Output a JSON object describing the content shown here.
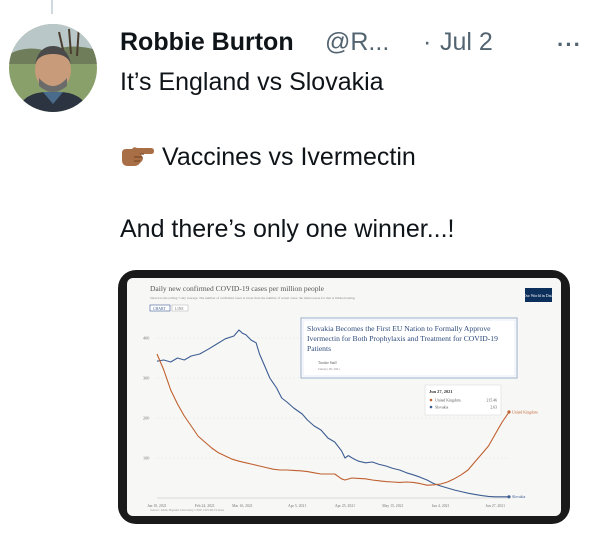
{
  "tweet": {
    "author_name": "Robbie Burton",
    "handle": "@R...",
    "separator": "·",
    "date": "Jul 2",
    "more_label": "···",
    "lines": [
      "It’s England vs Slovakia",
      "Vaccines vs Ivermectin",
      "And there’s only one winner...!"
    ]
  },
  "chart_image": {
    "title": "Daily new confirmed COVID-19 cases per million people",
    "subtitle": "Shown is the rolling 7-day average. The number of confirmed cases is lower than the number of actual cases; the main reason for that is limited testing.",
    "buttons": [
      "CHART",
      "LINE"
    ],
    "badge": "Our World in Data",
    "callout_text": [
      "Slovakia Becomes the First EU Nation to Formally Approve",
      "Ivermectin for Both Prophylaxis and Treatment for COVID-19",
      "Patients"
    ],
    "callout_source": "Trackie Staff",
    "callout_date": "January 28, 2021",
    "tooltip": {
      "date": "Jun 27, 2021",
      "rows": [
        {
          "name": "United Kingdom",
          "value": "215.46",
          "color": "#c0602f"
        },
        {
          "name": "Slovakia",
          "value": "2.63",
          "color": "#3d5d93"
        }
      ]
    },
    "footer": "Source: Johns Hopkins University CSSE COVID-19 Data"
  },
  "chart_data": {
    "type": "line",
    "title": "Daily new confirmed COVID-19 cases per million people",
    "y_ticks": [
      "400",
      "300",
      "200",
      "100"
    ],
    "x_ticks": [
      "Jan 10, 2021",
      "Feb 24, 2021",
      "Mar 16, 2021",
      "Apr 5, 2021",
      "Apr 25, 2021",
      "May 15, 2021",
      "Jun 4, 2021",
      "Jun 27, 2021"
    ],
    "ylim": [
      0,
      450
    ],
    "series": [
      {
        "name": "Slovakia",
        "color": "#3d5d93",
        "end_label": "Slovakia",
        "values": [
          [
            0,
            342
          ],
          [
            4,
            345
          ],
          [
            8,
            340
          ],
          [
            12,
            350
          ],
          [
            16,
            345
          ],
          [
            20,
            355
          ],
          [
            25,
            360
          ],
          [
            30,
            372
          ],
          [
            35,
            385
          ],
          [
            40,
            398
          ],
          [
            45,
            405
          ],
          [
            48,
            420
          ],
          [
            50,
            412
          ],
          [
            52,
            408
          ],
          [
            55,
            395
          ],
          [
            58,
            388
          ],
          [
            60,
            360
          ],
          [
            63,
            330
          ],
          [
            66,
            300
          ],
          [
            70,
            275
          ],
          [
            73,
            250
          ],
          [
            76,
            240
          ],
          [
            80,
            225
          ],
          [
            85,
            210
          ],
          [
            88,
            195
          ],
          [
            92,
            180
          ],
          [
            96,
            170
          ],
          [
            100,
            150
          ],
          [
            104,
            140
          ],
          [
            108,
            118
          ],
          [
            110,
            100
          ],
          [
            112,
            106
          ],
          [
            115,
            98
          ],
          [
            118,
            92
          ],
          [
            122,
            88
          ],
          [
            126,
            90
          ],
          [
            130,
            84
          ],
          [
            134,
            80
          ],
          [
            138,
            74
          ],
          [
            142,
            70
          ],
          [
            146,
            63
          ],
          [
            150,
            58
          ],
          [
            154,
            52
          ],
          [
            158,
            45
          ],
          [
            162,
            36
          ],
          [
            166,
            30
          ],
          [
            170,
            25
          ],
          [
            174,
            20
          ],
          [
            178,
            16
          ],
          [
            182,
            12
          ],
          [
            186,
            9
          ],
          [
            190,
            6
          ],
          [
            194,
            4
          ],
          [
            198,
            3
          ],
          [
            202,
            3
          ],
          [
            206,
            3
          ]
        ]
      },
      {
        "name": "United Kingdom",
        "color": "#c0602f",
        "end_label": "United Kingdom",
        "values": [
          [
            0,
            360
          ],
          [
            4,
            320
          ],
          [
            8,
            270
          ],
          [
            12,
            235
          ],
          [
            16,
            205
          ],
          [
            20,
            180
          ],
          [
            24,
            155
          ],
          [
            28,
            140
          ],
          [
            32,
            125
          ],
          [
            36,
            113
          ],
          [
            40,
            105
          ],
          [
            44,
            97
          ],
          [
            48,
            92
          ],
          [
            52,
            88
          ],
          [
            56,
            84
          ],
          [
            60,
            80
          ],
          [
            64,
            76
          ],
          [
            68,
            72
          ],
          [
            72,
            70
          ],
          [
            76,
            70
          ],
          [
            80,
            69
          ],
          [
            84,
            68
          ],
          [
            88,
            66
          ],
          [
            92,
            63
          ],
          [
            96,
            60
          ],
          [
            100,
            60
          ],
          [
            104,
            60
          ],
          [
            108,
            48
          ],
          [
            110,
            45
          ],
          [
            114,
            50
          ],
          [
            118,
            49
          ],
          [
            122,
            48
          ],
          [
            126,
            45
          ],
          [
            130,
            43
          ],
          [
            134,
            41
          ],
          [
            138,
            40
          ],
          [
            142,
            39
          ],
          [
            146,
            40
          ],
          [
            150,
            39
          ],
          [
            154,
            36
          ],
          [
            158,
            32
          ],
          [
            162,
            33
          ],
          [
            166,
            35
          ],
          [
            170,
            40
          ],
          [
            174,
            48
          ],
          [
            178,
            58
          ],
          [
            182,
            70
          ],
          [
            186,
            90
          ],
          [
            190,
            110
          ],
          [
            194,
            130
          ],
          [
            198,
            160
          ],
          [
            202,
            190
          ],
          [
            206,
            215
          ]
        ]
      }
    ]
  }
}
